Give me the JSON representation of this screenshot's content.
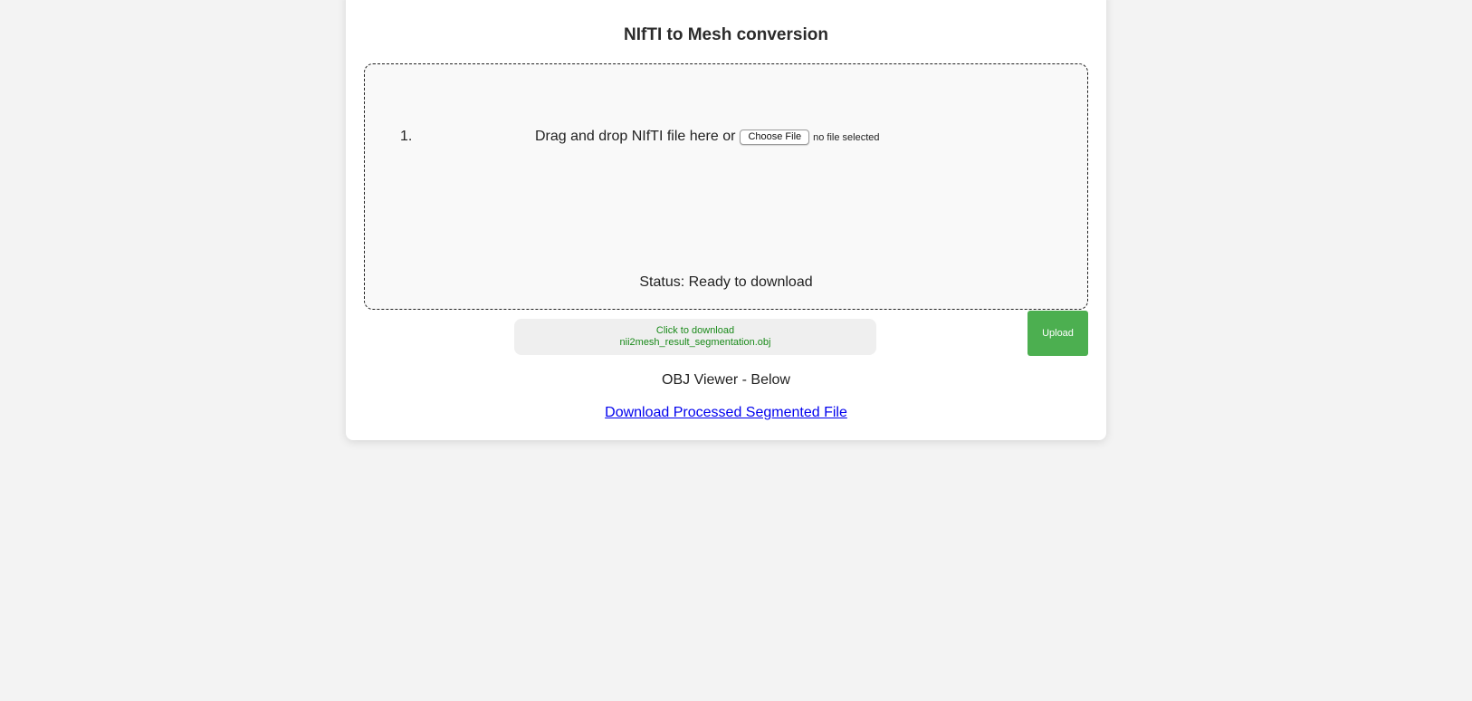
{
  "page": {
    "title": "NIfTI to Mesh conversion"
  },
  "dropzone": {
    "list_number": "1.",
    "drop_text": "Drag and drop NIfTI file here or",
    "choose_file_label": "Choose File",
    "file_status": "no file selected",
    "status": "Status: Ready to download"
  },
  "actions": {
    "download_line1": "Click to download",
    "download_line2": "nii2mesh_result_segmentation.obj",
    "upload_label": "Upload"
  },
  "footer": {
    "viewer_label": "OBJ Viewer - Below",
    "download_link": "Download Processed Segmented File"
  },
  "colors": {
    "upload_button": "#4caf50",
    "download_text": "#1a8a1a",
    "link": "#0000ee",
    "background": "#f3f3f3"
  }
}
